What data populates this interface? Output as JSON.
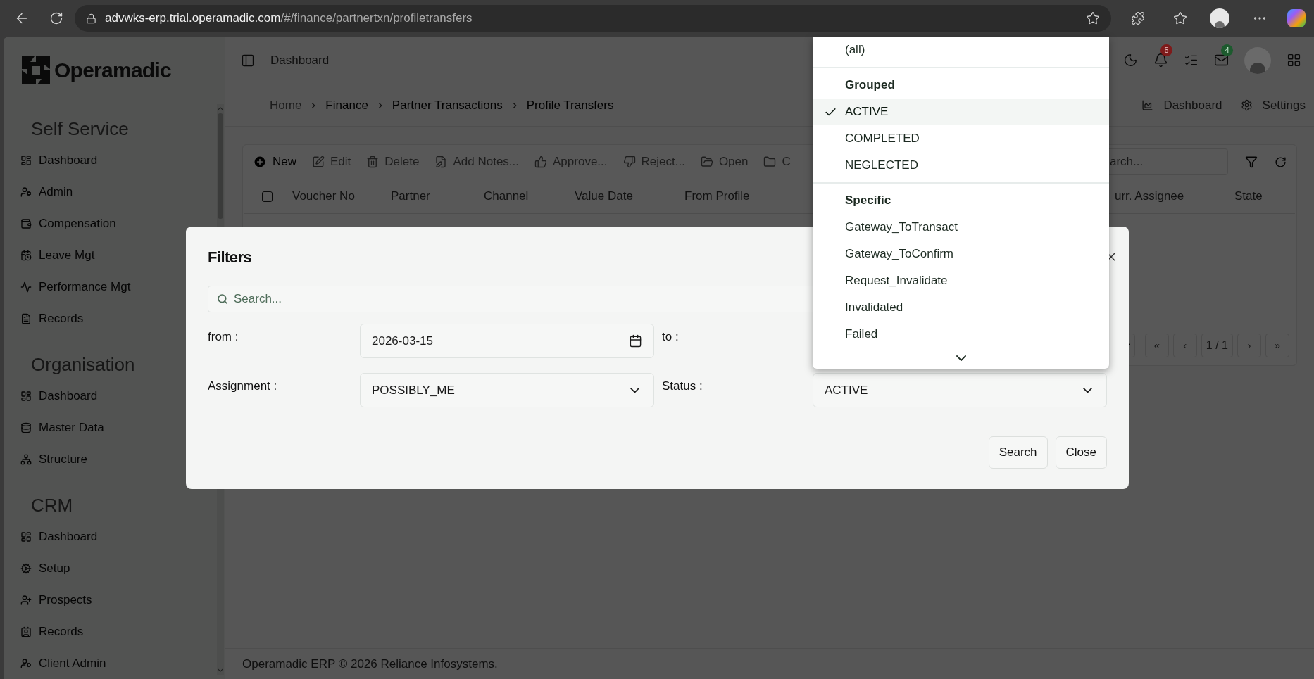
{
  "browser": {
    "url_host": "advwks-erp.trial.operamadic.com",
    "url_path": "/#/finance/partnertxn/profiletransfers"
  },
  "sidebar": {
    "logo": "Operamadic",
    "sections": [
      {
        "title": "Self Service",
        "items": [
          "Dashboard",
          "Admin",
          "Compensation",
          "Leave Mgt",
          "Performance Mgt",
          "Records"
        ]
      },
      {
        "title": "Organisation",
        "items": [
          "Dashboard",
          "Master Data",
          "Structure"
        ]
      },
      {
        "title": "CRM",
        "items": [
          "Dashboard",
          "Setup",
          "Prospects",
          "Records",
          "Client Admin"
        ]
      }
    ]
  },
  "header": {
    "title": "Dashboard",
    "notifications": "5",
    "messages": "4"
  },
  "breadcrumb": [
    {
      "label": "Home",
      "muted": true
    },
    {
      "label": "Finance",
      "muted": false
    },
    {
      "label": "Partner Transactions",
      "muted": false
    },
    {
      "label": "Profile Transfers",
      "muted": false
    }
  ],
  "page_links": [
    "Dashboard",
    "Settings"
  ],
  "toolbar": {
    "buttons": [
      {
        "label": "New",
        "disabled": false
      },
      {
        "label": "Edit",
        "disabled": true
      },
      {
        "label": "Delete",
        "disabled": true
      },
      {
        "label": "Add Notes...",
        "disabled": true
      },
      {
        "label": "Approve...",
        "disabled": true
      },
      {
        "label": "Reject...",
        "disabled": true
      },
      {
        "label": "Open",
        "disabled": true
      },
      {
        "label": "C",
        "disabled": true
      }
    ],
    "search_placeholder": "arch..."
  },
  "table": {
    "select_all": {
      "checked": false
    },
    "columns": [
      "Voucher No",
      "Partner",
      "Channel",
      "Value Date",
      "From Profile"
    ],
    "columns_right": [
      "urr. Assignee",
      "State"
    ]
  },
  "pagination": {
    "first": "«",
    "prev": "‹",
    "page": "1 / 1",
    "next": "›",
    "last": "»"
  },
  "footer": "Operamadic ERP © 2026 Reliance Infosystems.",
  "filters_dialog": {
    "title": "Filters",
    "search_placeholder": "Search...",
    "fields": [
      {
        "label": "from :",
        "kind": "date",
        "value": "2026-03-15"
      },
      {
        "label": "to :",
        "kind": "hidden"
      },
      {
        "label": "Assignment :",
        "kind": "select",
        "value": "POSSIBLY_ME"
      },
      {
        "label": "Status :",
        "kind": "select",
        "value": "ACTIVE"
      }
    ],
    "buttons": [
      "Search",
      "Close"
    ]
  },
  "status_dropdown": {
    "options": [
      {
        "kind": "option",
        "label": "(all)",
        "selected": false
      },
      {
        "kind": "heading",
        "label": "Grouped"
      },
      {
        "kind": "option",
        "label": "ACTIVE",
        "selected": true
      },
      {
        "kind": "option",
        "label": "COMPLETED",
        "selected": false
      },
      {
        "kind": "option",
        "label": "NEGLECTED",
        "selected": false
      },
      {
        "kind": "heading",
        "label": "Specific"
      },
      {
        "kind": "option",
        "label": "Gateway_ToTransact",
        "selected": false
      },
      {
        "kind": "option",
        "label": "Gateway_ToConfirm",
        "selected": false
      },
      {
        "kind": "option",
        "label": "Request_Invalidate",
        "selected": false
      },
      {
        "kind": "option",
        "label": "Invalidated",
        "selected": false
      },
      {
        "kind": "option",
        "label": "Failed",
        "selected": false
      }
    ]
  }
}
